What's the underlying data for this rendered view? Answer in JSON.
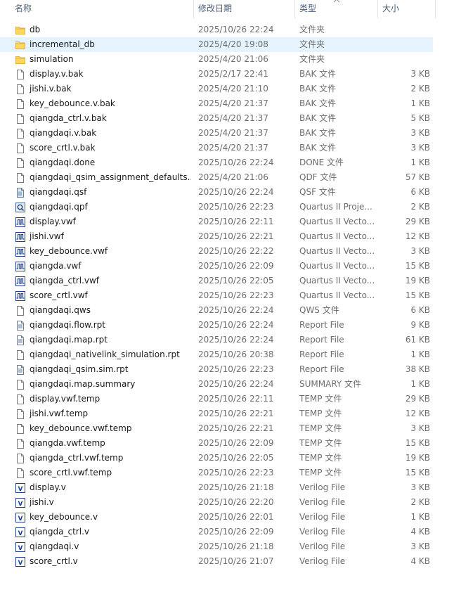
{
  "columns": {
    "name": "名称",
    "date": "修改日期",
    "type": "类型",
    "size": "大小"
  },
  "selected_index": 1,
  "files": [
    {
      "name": "db",
      "date": "2025/10/26 22:24",
      "type": "文件夹",
      "size": "",
      "icon": "folder-icon"
    },
    {
      "name": "incremental_db",
      "date": "2025/4/20 19:08",
      "type": "文件夹",
      "size": "",
      "icon": "folder-icon"
    },
    {
      "name": "simulation",
      "date": "2025/4/20 21:06",
      "type": "文件夹",
      "size": "",
      "icon": "folder-icon"
    },
    {
      "name": "display.v.bak",
      "date": "2025/2/17 22:41",
      "type": "BAK 文件",
      "size": "3 KB",
      "icon": "file-icon"
    },
    {
      "name": "jishi.v.bak",
      "date": "2025/4/20 21:10",
      "type": "BAK 文件",
      "size": "2 KB",
      "icon": "file-icon"
    },
    {
      "name": "key_debounce.v.bak",
      "date": "2025/4/20 21:37",
      "type": "BAK 文件",
      "size": "1 KB",
      "icon": "file-icon"
    },
    {
      "name": "qiangda_ctrl.v.bak",
      "date": "2025/4/20 21:37",
      "type": "BAK 文件",
      "size": "5 KB",
      "icon": "file-icon"
    },
    {
      "name": "qiangdaqi.v.bak",
      "date": "2025/4/20 21:37",
      "type": "BAK 文件",
      "size": "3 KB",
      "icon": "file-icon"
    },
    {
      "name": "score_crtl.v.bak",
      "date": "2025/4/20 21:37",
      "type": "BAK 文件",
      "size": "3 KB",
      "icon": "file-icon"
    },
    {
      "name": "qiangdaqi.done",
      "date": "2025/10/26 22:24",
      "type": "DONE 文件",
      "size": "1 KB",
      "icon": "file-icon"
    },
    {
      "name": "qiangdaqi_qsim_assignment_defaults....",
      "date": "2025/4/20 21:06",
      "type": "QDF 文件",
      "size": "57 KB",
      "icon": "file-icon"
    },
    {
      "name": "qiangdaqi.qsf",
      "date": "2025/10/26 22:24",
      "type": "QSF 文件",
      "size": "6 KB",
      "icon": "qsf-file-icon"
    },
    {
      "name": "qiangdaqi.qpf",
      "date": "2025/10/26 22:23",
      "type": "Quartus II Proje...",
      "size": "2 KB",
      "icon": "quartus-project-icon"
    },
    {
      "name": "display.vwf",
      "date": "2025/10/26 22:11",
      "type": "Quartus II Vecto...",
      "size": "29 KB",
      "icon": "waveform-icon"
    },
    {
      "name": "jishi.vwf",
      "date": "2025/10/26 22:21",
      "type": "Quartus II Vecto...",
      "size": "12 KB",
      "icon": "waveform-icon"
    },
    {
      "name": "key_debounce.vwf",
      "date": "2025/10/26 22:22",
      "type": "Quartus II Vecto...",
      "size": "3 KB",
      "icon": "waveform-icon"
    },
    {
      "name": "qiangda.vwf",
      "date": "2025/10/26 22:09",
      "type": "Quartus II Vecto...",
      "size": "15 KB",
      "icon": "waveform-icon"
    },
    {
      "name": "qiangda_ctrl.vwf",
      "date": "2025/10/26 22:05",
      "type": "Quartus II Vecto...",
      "size": "19 KB",
      "icon": "waveform-icon"
    },
    {
      "name": "score_crtl.vwf",
      "date": "2025/10/26 22:23",
      "type": "Quartus II Vecto...",
      "size": "15 KB",
      "icon": "waveform-icon"
    },
    {
      "name": "qiangdaqi.qws",
      "date": "2025/10/26 22:24",
      "type": "QWS 文件",
      "size": "6 KB",
      "icon": "file-icon"
    },
    {
      "name": "qiangdaqi.flow.rpt",
      "date": "2025/10/26 22:24",
      "type": "Report File",
      "size": "9 KB",
      "icon": "report-icon"
    },
    {
      "name": "qiangdaqi.map.rpt",
      "date": "2025/10/26 22:24",
      "type": "Report File",
      "size": "61 KB",
      "icon": "report-icon"
    },
    {
      "name": "qiangdaqi_nativelink_simulation.rpt",
      "date": "2025/10/26 20:38",
      "type": "Report File",
      "size": "1 KB",
      "icon": "file-icon"
    },
    {
      "name": "qiangdaqi_qsim.sim.rpt",
      "date": "2025/10/26 22:23",
      "type": "Report File",
      "size": "38 KB",
      "icon": "report-icon"
    },
    {
      "name": "qiangdaqi.map.summary",
      "date": "2025/10/26 22:24",
      "type": "SUMMARY 文件",
      "size": "1 KB",
      "icon": "file-icon"
    },
    {
      "name": "display.vwf.temp",
      "date": "2025/10/26 22:11",
      "type": "TEMP 文件",
      "size": "29 KB",
      "icon": "file-icon"
    },
    {
      "name": "jishi.vwf.temp",
      "date": "2025/10/26 22:21",
      "type": "TEMP 文件",
      "size": "12 KB",
      "icon": "file-icon"
    },
    {
      "name": "key_debounce.vwf.temp",
      "date": "2025/10/26 22:21",
      "type": "TEMP 文件",
      "size": "3 KB",
      "icon": "file-icon"
    },
    {
      "name": "qiangda.vwf.temp",
      "date": "2025/10/26 22:09",
      "type": "TEMP 文件",
      "size": "15 KB",
      "icon": "file-icon"
    },
    {
      "name": "qiangda_ctrl.vwf.temp",
      "date": "2025/10/26 22:05",
      "type": "TEMP 文件",
      "size": "19 KB",
      "icon": "file-icon"
    },
    {
      "name": "score_crtl.vwf.temp",
      "date": "2025/10/26 22:23",
      "type": "TEMP 文件",
      "size": "15 KB",
      "icon": "file-icon"
    },
    {
      "name": "display.v",
      "date": "2025/10/26 21:18",
      "type": "Verilog File",
      "size": "3 KB",
      "icon": "verilog-icon"
    },
    {
      "name": "jishi.v",
      "date": "2025/10/26 22:20",
      "type": "Verilog File",
      "size": "2 KB",
      "icon": "verilog-icon"
    },
    {
      "name": "key_debounce.v",
      "date": "2025/10/26 22:01",
      "type": "Verilog File",
      "size": "1 KB",
      "icon": "verilog-icon"
    },
    {
      "name": "qiangda_ctrl.v",
      "date": "2025/10/26 22:09",
      "type": "Verilog File",
      "size": "4 KB",
      "icon": "verilog-icon"
    },
    {
      "name": "qiangdaqi.v",
      "date": "2025/10/26 21:18",
      "type": "Verilog File",
      "size": "3 KB",
      "icon": "verilog-icon"
    },
    {
      "name": "score_crtl.v",
      "date": "2025/10/26 21:07",
      "type": "Verilog File",
      "size": "4 KB",
      "icon": "verilog-icon"
    }
  ]
}
